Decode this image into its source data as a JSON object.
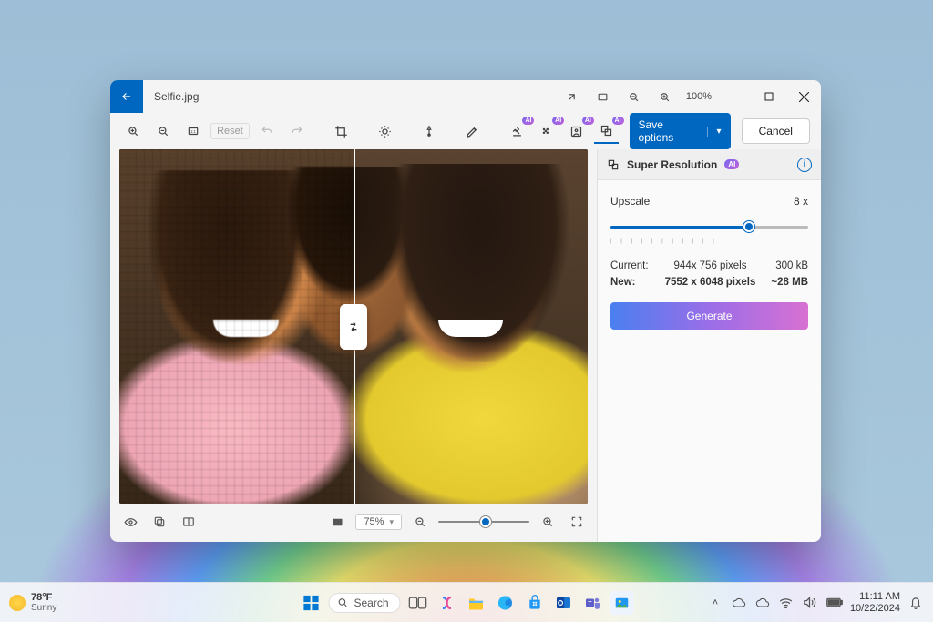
{
  "titlebar": {
    "filename": "Selfie.jpg",
    "zoom": "100%"
  },
  "toolbar": {
    "reset": "Reset",
    "save": "Save options",
    "cancel": "Cancel"
  },
  "bottom": {
    "zoom_pct": "75%"
  },
  "panel": {
    "title": "Super Resolution",
    "ai_badge": "AI",
    "upscale_label": "Upscale",
    "upscale_value": "8 x",
    "current_label": "Current:",
    "current_dims": "944x 756 pixels",
    "current_size": "300 kB",
    "new_label": "New:",
    "new_dims": "7552 x 6048 pixels",
    "new_size": "~28 MB",
    "generate": "Generate"
  },
  "taskbar": {
    "temp": "78°F",
    "weather": "Sunny",
    "search": "Search",
    "time": "11:11 AM",
    "date": "10/22/2024"
  }
}
